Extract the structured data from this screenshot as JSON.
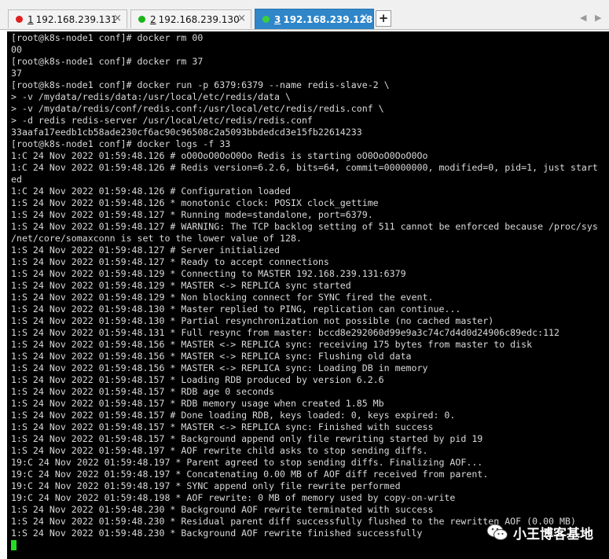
{
  "tabs": [
    {
      "number": "1",
      "host": "192.168.239.131",
      "active": false,
      "status_color": "#e02020"
    },
    {
      "number": "2",
      "host": "192.168.239.130",
      "active": false,
      "status_color": "#19b419"
    },
    {
      "number": "3",
      "host": "192.168.239.128",
      "active": true,
      "status_color": "#3ad13a"
    }
  ],
  "tab_close_glyph": "×",
  "add_tab_label": "+",
  "nav": {
    "prev": "◀",
    "next": "▶"
  },
  "terminal": {
    "lines": [
      "[root@k8s-node1 conf]# docker rm 00",
      "00",
      "[root@k8s-node1 conf]# docker rm 37",
      "37",
      "[root@k8s-node1 conf]# docker run -p 6379:6379 --name redis-slave-2 \\",
      "> -v /mydata/redis/data:/usr/local/etc/redis/data \\",
      "> -v /mydata/redis/conf/redis.conf:/usr/local/etc/redis/redis.conf \\",
      "> -d redis redis-server /usr/local/etc/redis/redis.conf",
      "33aafa17eedb1cb58ade230cf6ac90c96508c2a5093bbdedcd3e15fb22614233",
      "[root@k8s-node1 conf]# docker logs -f 33",
      "1:C 24 Nov 2022 01:59:48.126 # oO0OoO0OoO0Oo Redis is starting oO0OoO0OoO0Oo",
      "1:C 24 Nov 2022 01:59:48.126 # Redis version=6.2.6, bits=64, commit=00000000, modified=0, pid=1, just start",
      "ed",
      "1:C 24 Nov 2022 01:59:48.126 # Configuration loaded",
      "1:S 24 Nov 2022 01:59:48.126 * monotonic clock: POSIX clock_gettime",
      "1:S 24 Nov 2022 01:59:48.127 * Running mode=standalone, port=6379.",
      "1:S 24 Nov 2022 01:59:48.127 # WARNING: The TCP backlog setting of 511 cannot be enforced because /proc/sys",
      "/net/core/somaxconn is set to the lower value of 128.",
      "1:S 24 Nov 2022 01:59:48.127 # Server initialized",
      "1:S 24 Nov 2022 01:59:48.127 * Ready to accept connections",
      "1:S 24 Nov 2022 01:59:48.129 * Connecting to MASTER 192.168.239.131:6379",
      "1:S 24 Nov 2022 01:59:48.129 * MASTER <-> REPLICA sync started",
      "1:S 24 Nov 2022 01:59:48.129 * Non blocking connect for SYNC fired the event.",
      "1:S 24 Nov 2022 01:59:48.130 * Master replied to PING, replication can continue...",
      "1:S 24 Nov 2022 01:59:48.130 * Partial resynchronization not possible (no cached master)",
      "1:S 24 Nov 2022 01:59:48.131 * Full resync from master: bccd8e292060d99e9a3c74c7d4d0d24906c89edc:112",
      "1:S 24 Nov 2022 01:59:48.156 * MASTER <-> REPLICA sync: receiving 175 bytes from master to disk",
      "1:S 24 Nov 2022 01:59:48.156 * MASTER <-> REPLICA sync: Flushing old data",
      "1:S 24 Nov 2022 01:59:48.156 * MASTER <-> REPLICA sync: Loading DB in memory",
      "1:S 24 Nov 2022 01:59:48.157 * Loading RDB produced by version 6.2.6",
      "1:S 24 Nov 2022 01:59:48.157 * RDB age 0 seconds",
      "1:S 24 Nov 2022 01:59:48.157 * RDB memory usage when created 1.85 Mb",
      "1:S 24 Nov 2022 01:59:48.157 # Done loading RDB, keys loaded: 0, keys expired: 0.",
      "1:S 24 Nov 2022 01:59:48.157 * MASTER <-> REPLICA sync: Finished with success",
      "1:S 24 Nov 2022 01:59:48.157 * Background append only file rewriting started by pid 19",
      "1:S 24 Nov 2022 01:59:48.197 * AOF rewrite child asks to stop sending diffs.",
      "19:C 24 Nov 2022 01:59:48.197 * Parent agreed to stop sending diffs. Finalizing AOF...",
      "19:C 24 Nov 2022 01:59:48.197 * Concatenating 0.00 MB of AOF diff received from parent.",
      "19:C 24 Nov 2022 01:59:48.197 * SYNC append only file rewrite performed",
      "19:C 24 Nov 2022 01:59:48.198 * AOF rewrite: 0 MB of memory used by copy-on-write",
      "1:S 24 Nov 2022 01:59:48.230 * Background AOF rewrite terminated with success",
      "1:S 24 Nov 2022 01:59:48.230 * Residual parent diff successfully flushed to the rewritten AOF (0.00 MB)",
      "1:S 24 Nov 2022 01:59:48.230 * Background AOF rewrite finished successfully"
    ]
  },
  "watermark": {
    "text": "小王博客基地",
    "icon": "wechat-icon"
  }
}
